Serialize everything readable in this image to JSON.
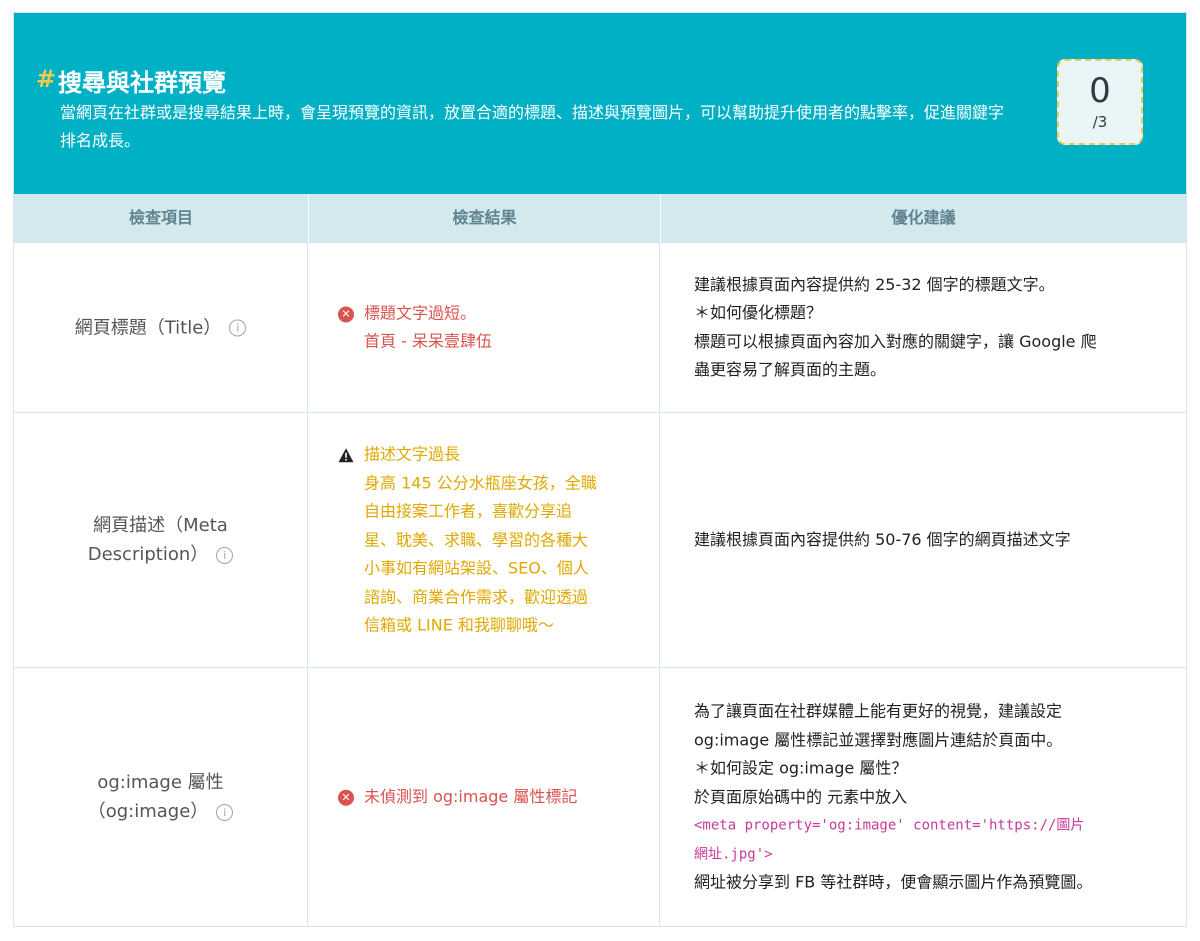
{
  "header": {
    "hash": "#",
    "title": "搜尋與社群預覽",
    "description": "當網頁在社群或是搜尋結果上時，會呈現預覽的資訊，放置合適的標題、描述與預覽圖片，可以幫助提升使用者的點擊率，促進關鍵字排名成長。",
    "score": "0",
    "score_total": "/3"
  },
  "table": {
    "columns": [
      "檢查項目",
      "檢查結果",
      "優化建議"
    ],
    "rows": [
      {
        "item_lines": [
          "網頁標題（Title）"
        ],
        "status": "error",
        "result_lines": [
          "標題文字過短。",
          "首頁 - 呆呆壹肆伍"
        ],
        "advice_lines": [
          "建議根據頁面內容提供約 25-32 個字的標題文字。",
          "＊如何優化標題？",
          "標題可以根據頁面內容加入對應的關鍵字，讓 Google 爬",
          "蟲更容易了解頁面的主題。"
        ]
      },
      {
        "item_lines": [
          "網頁描述（Meta",
          "Description）"
        ],
        "status": "warning",
        "result_lines": [
          "描述文字過長",
          "身高 145 公分水瓶座女孩，全職",
          "自由接案工作者，喜歡分享追",
          "星、耽美、求職、學習的各種大",
          "小事如有網站架設、SEO、個人",
          "諮詢、商業合作需求，歡迎透過",
          "信箱或 LINE 和我聊聊哦～"
        ],
        "advice_lines": [
          "建議根據頁面內容提供約 50-76 個字的網頁描述文字"
        ]
      },
      {
        "item_lines": [
          "og:image 屬性",
          "（og:image）"
        ],
        "status": "error",
        "result_lines": [
          "未偵測到 og:image 屬性標記"
        ],
        "advice_lines": [
          "為了讓頁面在社群媒體上能有更好的視覺，建議設定",
          "og:image 屬性標記並選擇對應圖片連結於頁面中。",
          "＊如何設定 og:image 屬性？",
          "於頁面原始碼中的 元素中放入"
        ],
        "advice_code": [
          "<meta property='og:image' content='https://圖片",
          "網址.jpg'>"
        ],
        "advice_after": [
          "網址被分享到 FB 等社群時，便會顯示圖片作為預覽圖。"
        ]
      }
    ]
  },
  "colors": {
    "header_bg": "#00b1c6",
    "table_head_bg": "#d4e9ee",
    "error": "#d9534f",
    "warning": "#e0a800",
    "code": "#c73b9a",
    "score_border": "#f2c94c"
  },
  "icons": {
    "error": "x-circle-icon",
    "warning": "warning-triangle-icon",
    "info": "info-icon"
  }
}
